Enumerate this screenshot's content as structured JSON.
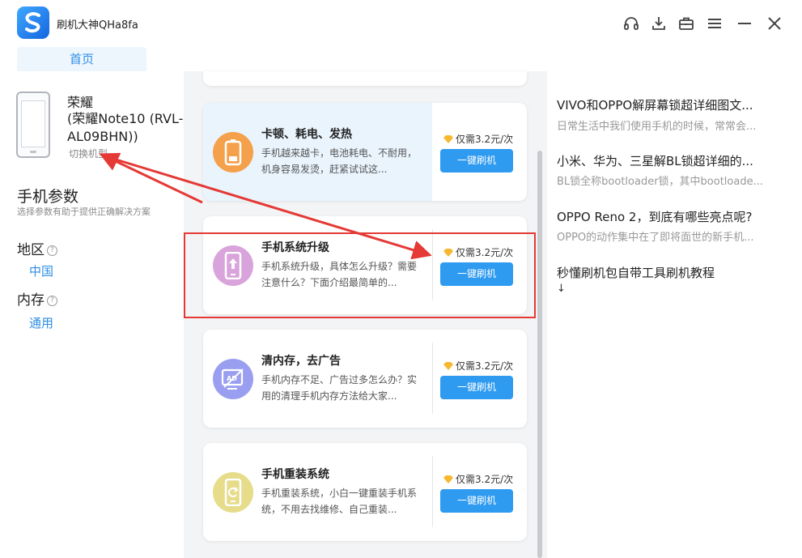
{
  "app": {
    "title": "刷机大神QHa8fa",
    "toolbar_icons": [
      "headset-icon",
      "download-icon",
      "toolbox-icon",
      "menu-icon",
      "minimize-icon",
      "close-icon"
    ]
  },
  "tabs": {
    "home": "首页"
  },
  "device": {
    "brand": "荣耀",
    "model": "(荣耀Note10 (RVL-AL09BHN))",
    "switch_label": "切换机型"
  },
  "params": {
    "title": "手机参数",
    "subtitle": "选择参数有助于提供正确解决方案",
    "region_label": "地区",
    "region_value": "中国",
    "memory_label": "内存",
    "memory_value": "通用",
    "help_glyph": "?"
  },
  "cards": [
    {
      "title": "卡顿、耗电、发热",
      "desc": "手机越来越卡，电池耗电、不耐用，机身容易发烫，赶紧试试这...",
      "price": "仅需3.2元/次",
      "button": "一键刷机",
      "icon": "battery-icon",
      "color": "#f5a04a"
    },
    {
      "title": "手机系统升级",
      "desc": "手机系统升级，具体怎么升级？需要注意什么？下面介绍最简单的...",
      "price": "仅需3.2元/次",
      "button": "一键刷机",
      "icon": "phone-upgrade-icon",
      "color": "#d9a3dc"
    },
    {
      "title": "清内存，去广告",
      "desc": "手机内存不足、广告过多怎么办？实用的清理手机内存方法给大家...",
      "price": "仅需3.2元/次",
      "button": "一键刷机",
      "icon": "ad-block-icon",
      "color": "#9a9ef0"
    },
    {
      "title": "手机重装系统",
      "desc": "手机重装系统，小白一键重装手机系统，不用去找维修、自己重装...",
      "price": "仅需3.2元/次",
      "button": "一键刷机",
      "icon": "phone-reinstall-icon",
      "color": "#e6dc8a"
    }
  ],
  "articles": [
    {
      "title": "VIVO和OPPO解屏幕锁超详细图文...",
      "summary": "日常生活中我们使用手机的时候，常常会..."
    },
    {
      "title": "小米、华为、三星解BL锁超详细的...",
      "summary": "BL锁全称bootloader锁，其中bootloade..."
    },
    {
      "title": "OPPO Reno 2，到底有哪些亮点呢?",
      "summary": "OPPO的动作集中在了即将面世的新手机..."
    },
    {
      "title": "秒懂刷机包自带工具刷机教程",
      "summary": "↓"
    }
  ],
  "colors": {
    "accent": "#2e9af0",
    "annotation": "#e53935"
  }
}
